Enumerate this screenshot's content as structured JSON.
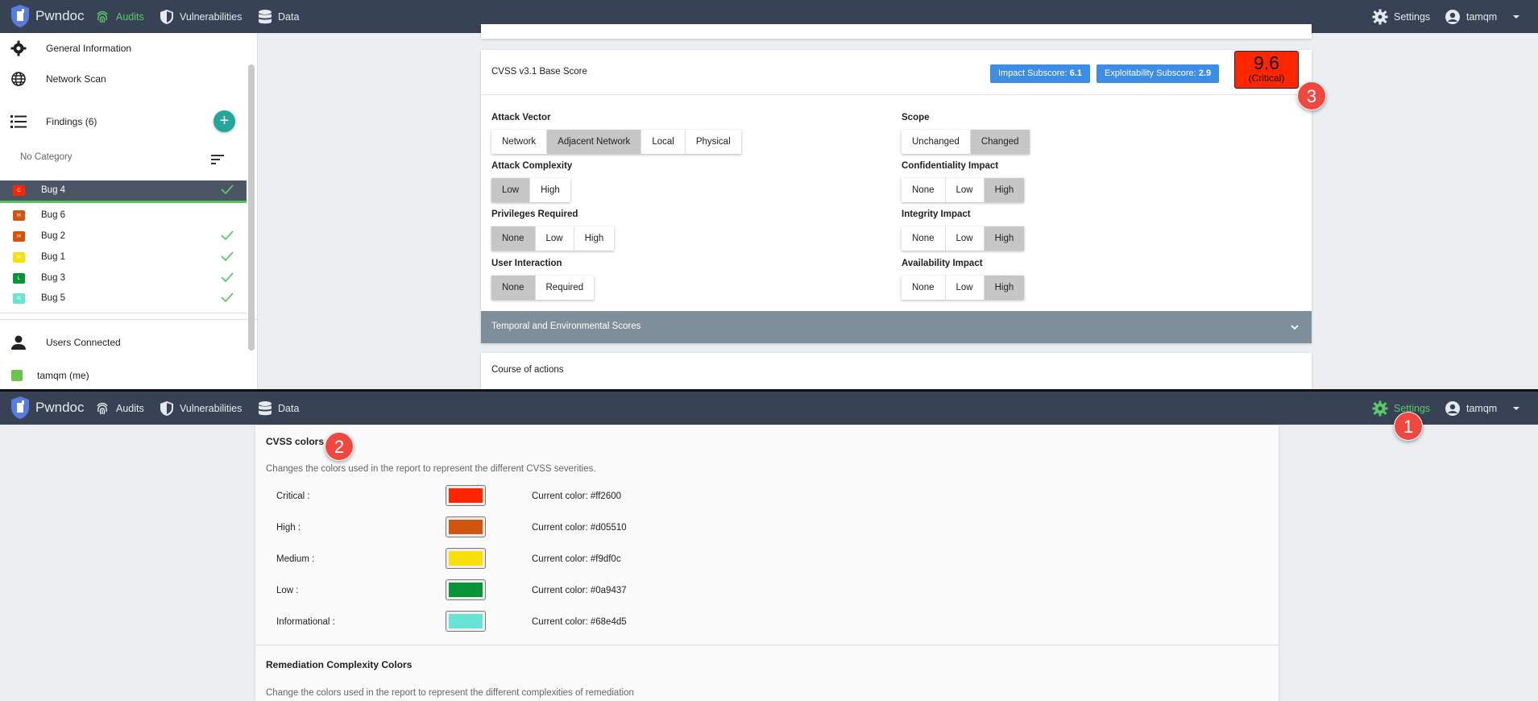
{
  "top": {
    "nav": {
      "brand": "Pwndoc",
      "items": [
        {
          "label": "Audits",
          "icon": "fingerprint-icon"
        },
        {
          "label": "Vulnerabilities",
          "icon": "shield-icon"
        },
        {
          "label": "Data",
          "icon": "database-icon"
        }
      ],
      "settings_label": "Settings",
      "user_label": "tamqm"
    },
    "sidebar": {
      "general_information": "General Information",
      "network_scan": "Network Scan",
      "findings": "Findings (6)",
      "add_symbol": "+",
      "no_category": "No Category",
      "findings_list": [
        {
          "name": "Bug 4",
          "badge": "C",
          "color": "#ff2600",
          "checked": true
        },
        {
          "name": "Bug 6",
          "badge": "H",
          "color": "#d05510",
          "checked": false
        },
        {
          "name": "Bug 2",
          "badge": "H",
          "color": "#d05510",
          "checked": true
        },
        {
          "name": "Bug 1",
          "badge": "M",
          "color": "#f9df0c",
          "checked": true
        },
        {
          "name": "Bug 3",
          "badge": "L",
          "color": "#0a9437",
          "checked": true
        },
        {
          "name": "Bug 5",
          "badge": "N",
          "color": "#68e4d5",
          "checked": true
        }
      ],
      "users_connected": "Users Connected",
      "user_me": "tamqm (me)"
    },
    "cvss": {
      "title": "CVSS v3.1 Base Score",
      "impact_label": "Impact Subscore:",
      "impact_value": "6.1",
      "exploitability_label": "Exploitability Subscore:",
      "exploitability_value": "2.9",
      "score": "9.6",
      "severity": "(Critical)",
      "metrics": {
        "attack_vector": {
          "label": "Attack Vector",
          "options": [
            "Network",
            "Adjacent Network",
            "Local",
            "Physical"
          ],
          "selected": "Adjacent Network"
        },
        "attack_complexity": {
          "label": "Attack Complexity",
          "options": [
            "Low",
            "High"
          ],
          "selected": "Low"
        },
        "privileges_required": {
          "label": "Privileges Required",
          "options": [
            "None",
            "Low",
            "High"
          ],
          "selected": "None"
        },
        "user_interaction": {
          "label": "User Interaction",
          "options": [
            "None",
            "Required"
          ],
          "selected": "None"
        },
        "scope": {
          "label": "Scope",
          "options": [
            "Unchanged",
            "Changed"
          ],
          "selected": "Changed"
        },
        "confidentiality": {
          "label": "Confidentiality Impact",
          "options": [
            "None",
            "Low",
            "High"
          ],
          "selected": "High"
        },
        "integrity": {
          "label": "Integrity Impact",
          "options": [
            "None",
            "Low",
            "High"
          ],
          "selected": "High"
        },
        "availability": {
          "label": "Availability Impact",
          "options": [
            "None",
            "Low",
            "High"
          ],
          "selected": "High"
        }
      },
      "temporal_label": "Temporal and Environmental Scores"
    },
    "course_of_actions": "Course of actions",
    "step3": "3"
  },
  "bottom": {
    "nav": {
      "brand": "Pwndoc",
      "items": [
        {
          "label": "Audits",
          "icon": "fingerprint-icon"
        },
        {
          "label": "Vulnerabilities",
          "icon": "shield-icon"
        },
        {
          "label": "Data",
          "icon": "database-icon"
        }
      ],
      "settings_label": "Settings",
      "user_label": "tamqm"
    },
    "cvss_colors": {
      "title": "CVSS colors",
      "description": "Changes the colors used in the report to represent the different CVSS severities.",
      "rows": [
        {
          "label": "Critical :",
          "color": "#ff2600",
          "current": "Current color: #ff2600"
        },
        {
          "label": "High :",
          "color": "#d05510",
          "current": "Current color: #d05510"
        },
        {
          "label": "Medium :",
          "color": "#f9df0c",
          "current": "Current color: #f9df0c"
        },
        {
          "label": "Low :",
          "color": "#0a9437",
          "current": "Current color: #0a9437"
        },
        {
          "label": "Informational :",
          "color": "#68e4d5",
          "current": "Current color: #68e4d5"
        }
      ]
    },
    "remediation": {
      "title": "Remediation Complexity Colors",
      "description": "Change the colors used in the report to represent the different complexities of remediation"
    },
    "step1": "1",
    "step2": "2"
  },
  "colors": {
    "navbar": "#374355",
    "active_green": "#5bc96b",
    "pill_blue": "#3d8ce6",
    "step_red": "#f0483e",
    "critical": "#ff2600"
  }
}
